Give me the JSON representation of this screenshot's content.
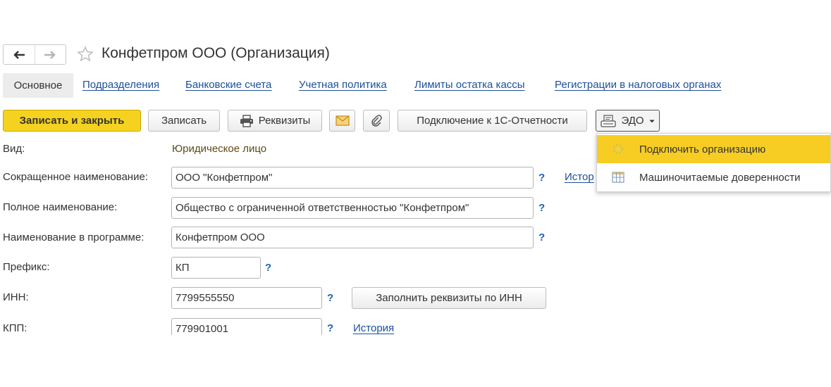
{
  "header": {
    "title": "Конфетпром ООО (Организация)"
  },
  "tabs": [
    {
      "label": "Основное"
    },
    {
      "label": "Подразделения"
    },
    {
      "label": "Банковские счета"
    },
    {
      "label": "Учетная политика"
    },
    {
      "label": "Лимиты остатка кассы"
    },
    {
      "label": "Регистрации в налоговых органах"
    }
  ],
  "toolbar": {
    "save_close": "Записать и закрыть",
    "save": "Записать",
    "requisites": "Реквизиты",
    "connect_reporting": "Подключение к 1С-Отчетности",
    "edo": "ЭДО"
  },
  "edo_menu": {
    "items": [
      {
        "label": "Подключить организацию"
      },
      {
        "label": "Машиночитаемые доверенности"
      }
    ]
  },
  "form": {
    "vid_label": "Вид:",
    "vid_value": "Юридическое лицо",
    "short_name_label": "Сокращенное наименование:",
    "short_name_value": "ООО \"Конфетпром\"",
    "full_name_label": "Полное наименование:",
    "full_name_value": "Общество с ограниченной ответственностью \"Конфетпром\"",
    "program_name_label": "Наименование в программе:",
    "program_name_value": "Конфетпром ООО",
    "prefix_label": "Префикс:",
    "prefix_value": "КП",
    "inn_label": "ИНН:",
    "inn_value": "7799555550",
    "fill_by_inn": "Заполнить реквизиты по ИНН",
    "kpp_label": "КПП:",
    "kpp_value": "779901001",
    "help": "?",
    "history_link_partial": "Истор",
    "history_link": "История"
  },
  "colors": {
    "accent_yellow": "#f5d21f",
    "link_blue": "#1c4f9c",
    "help_blue": "#1c62b3",
    "menu_highlight": "#f7cd24"
  }
}
